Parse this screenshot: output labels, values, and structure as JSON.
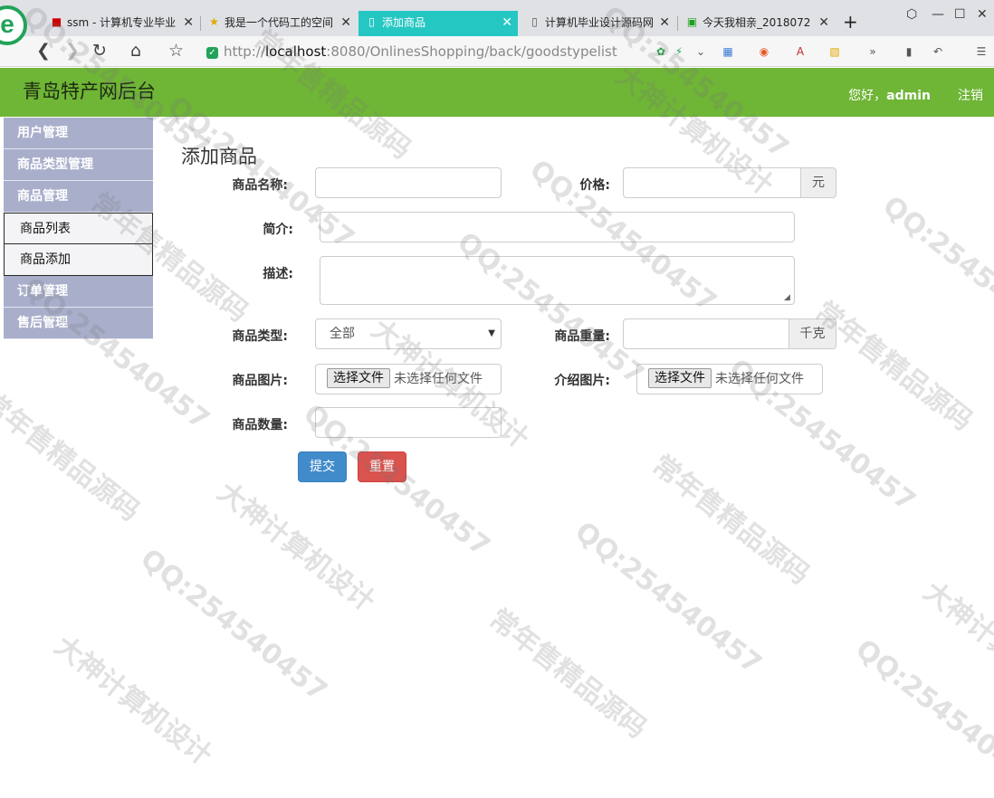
{
  "browser": {
    "logo": "e",
    "tabs": [
      {
        "label": "ssm - 计算机专业毕业",
        "favicon": "flag-icon",
        "active": false
      },
      {
        "label": "我是一个代码工的空间",
        "favicon": "star-icon",
        "active": false
      },
      {
        "label": "添加商品",
        "favicon": "page-icon",
        "active": true
      },
      {
        "label": "计算机毕业设计源码网",
        "favicon": "page-icon",
        "active": false
      },
      {
        "label": "今天我相亲_2018072",
        "favicon": "iqiyi-icon",
        "active": false
      }
    ],
    "url_scheme": "http://",
    "url_host": "localhost",
    "url_rest": ":8080/OnlinesShopping/back/goodstypelist"
  },
  "header": {
    "brand": "青岛特产网后台",
    "greeting": "您好，",
    "username": "admin",
    "logout": "注销"
  },
  "sidebar": {
    "items": [
      {
        "label": "用户管理"
      },
      {
        "label": "商品类型管理"
      },
      {
        "label": "商品管理"
      }
    ],
    "subitems": [
      {
        "label": "商品列表"
      },
      {
        "label": "商品添加"
      }
    ],
    "items_after": [
      {
        "label": "订单管理"
      },
      {
        "label": "售后管理"
      }
    ]
  },
  "form": {
    "title": "添加商品",
    "name_label": "商品名称:",
    "price_label": "价格:",
    "price_unit": "元",
    "intro_label": "简介:",
    "desc_label": "描述:",
    "type_label": "商品类型:",
    "type_value": "全部",
    "weight_label": "商品重量:",
    "weight_unit": "千克",
    "image_label": "商品图片:",
    "intro_image_label": "介绍图片:",
    "choose_file": "选择文件",
    "no_file": "未选择任何文件",
    "qty_label": "商品数量:",
    "submit": "提交",
    "reset": "重置"
  },
  "watermark": {
    "texts": [
      "常年售精品源码",
      "QQ:254540457",
      "大神计算机设计"
    ]
  },
  "colors": {
    "header_green": "#6fb536",
    "sidebar_item": "#a9afcb",
    "active_tab": "#25c7c3",
    "primary": "#428bca",
    "danger": "#d9534f"
  }
}
